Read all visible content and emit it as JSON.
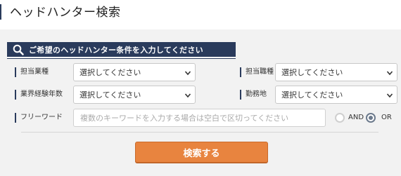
{
  "page": {
    "title": "ヘッドハンター検索"
  },
  "search_panel": {
    "heading": "ご希望のヘッドハンター条件を入力してください",
    "fields": {
      "industry": {
        "label": "担当業種",
        "value": "選択してください"
      },
      "occupation": {
        "label": "担当職種",
        "value": "選択してください"
      },
      "experience": {
        "label": "業界経験年数",
        "value": "選択してください"
      },
      "location": {
        "label": "勤務地",
        "value": "選択してください"
      },
      "freeword": {
        "label": "フリーワード",
        "placeholder": "複数のキーワードを入力する場合は空白で区切ってください",
        "value": ""
      }
    },
    "match_mode": {
      "options": [
        "AND",
        "OR"
      ],
      "selected": "OR"
    },
    "submit_label": "検索する"
  },
  "colors": {
    "navy": "#2a3b5c",
    "panel_bg": "#f2f2f2",
    "button_orange": "#e8843f"
  }
}
